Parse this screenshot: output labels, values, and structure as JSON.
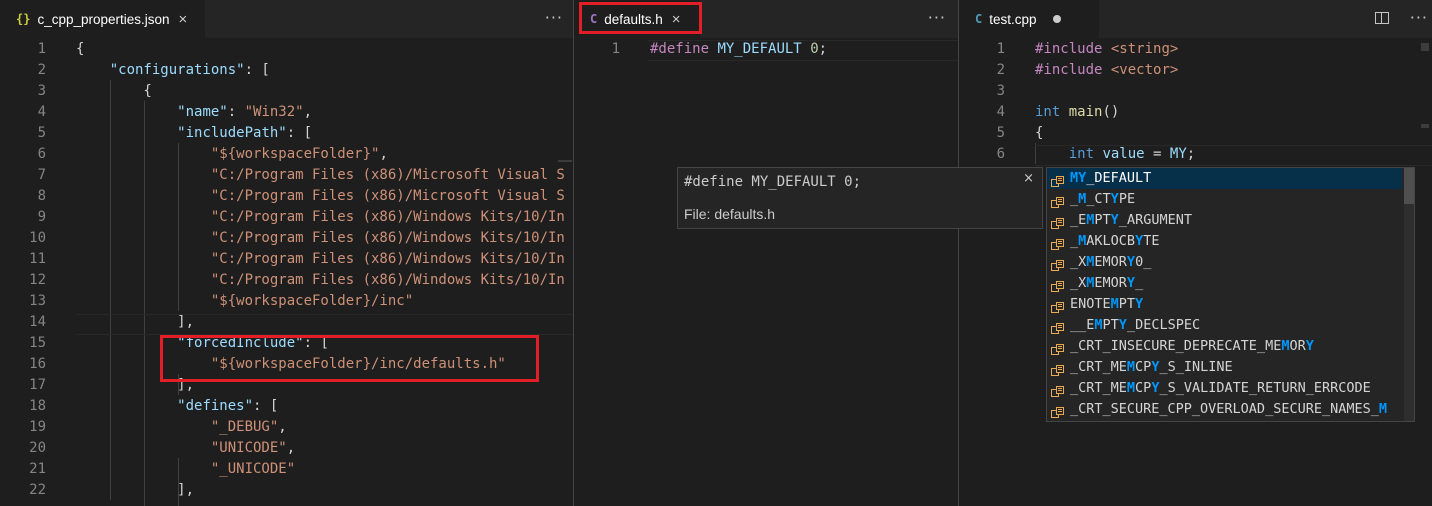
{
  "editors": [
    {
      "tab": {
        "icon": "{}",
        "icon_name": "json-icon",
        "label": "c_cpp_properties.json",
        "close": "×"
      },
      "more": "···",
      "lines": [
        {
          "n": "1",
          "parts": [
            [
              "p",
              "{"
            ]
          ]
        },
        {
          "n": "2",
          "parts": [
            [
              "p",
              "    "
            ],
            [
              "k",
              "\"configurations\""
            ],
            [
              "p",
              ": ["
            ]
          ]
        },
        {
          "n": "3",
          "parts": [
            [
              "p",
              "        {"
            ]
          ]
        },
        {
          "n": "4",
          "parts": [
            [
              "p",
              "            "
            ],
            [
              "k",
              "\"name\""
            ],
            [
              "p",
              ": "
            ],
            [
              "s",
              "\"Win32\""
            ],
            [
              "p",
              ","
            ]
          ]
        },
        {
          "n": "5",
          "parts": [
            [
              "p",
              "            "
            ],
            [
              "k",
              "\"includePath\""
            ],
            [
              "p",
              ": ["
            ]
          ]
        },
        {
          "n": "6",
          "parts": [
            [
              "p",
              "                "
            ],
            [
              "s",
              "\"${workspaceFolder}\""
            ],
            [
              "p",
              ","
            ]
          ]
        },
        {
          "n": "7",
          "parts": [
            [
              "p",
              "                "
            ],
            [
              "s",
              "\"C:/Program Files (x86)/Microsoft Visual S"
            ]
          ]
        },
        {
          "n": "8",
          "parts": [
            [
              "p",
              "                "
            ],
            [
              "s",
              "\"C:/Program Files (x86)/Microsoft Visual S"
            ]
          ]
        },
        {
          "n": "9",
          "parts": [
            [
              "p",
              "                "
            ],
            [
              "s",
              "\"C:/Program Files (x86)/Windows Kits/10/In"
            ]
          ]
        },
        {
          "n": "10",
          "parts": [
            [
              "p",
              "                "
            ],
            [
              "s",
              "\"C:/Program Files (x86)/Windows Kits/10/In"
            ]
          ]
        },
        {
          "n": "11",
          "parts": [
            [
              "p",
              "                "
            ],
            [
              "s",
              "\"C:/Program Files (x86)/Windows Kits/10/In"
            ]
          ]
        },
        {
          "n": "12",
          "parts": [
            [
              "p",
              "                "
            ],
            [
              "s",
              "\"C:/Program Files (x86)/Windows Kits/10/In"
            ]
          ]
        },
        {
          "n": "13",
          "parts": [
            [
              "p",
              "                "
            ],
            [
              "s",
              "\"${workspaceFolder}/inc\""
            ]
          ]
        },
        {
          "n": "14",
          "parts": [
            [
              "p",
              "            ],"
            ]
          ]
        },
        {
          "n": "15",
          "parts": [
            [
              "p",
              "            "
            ],
            [
              "k",
              "\"forcedInclude\""
            ],
            [
              "p",
              ": ["
            ]
          ]
        },
        {
          "n": "16",
          "parts": [
            [
              "p",
              "                "
            ],
            [
              "s",
              "\"${workspaceFolder}/inc/defaults.h\""
            ]
          ]
        },
        {
          "n": "17",
          "parts": [
            [
              "p",
              "            ],"
            ]
          ]
        },
        {
          "n": "18",
          "parts": [
            [
              "p",
              "            "
            ],
            [
              "k",
              "\"defines\""
            ],
            [
              "p",
              ": ["
            ]
          ]
        },
        {
          "n": "19",
          "parts": [
            [
              "p",
              "                "
            ],
            [
              "s",
              "\"_DEBUG\""
            ],
            [
              "p",
              ","
            ]
          ]
        },
        {
          "n": "20",
          "parts": [
            [
              "p",
              "                "
            ],
            [
              "s",
              "\"UNICODE\""
            ],
            [
              "p",
              ","
            ]
          ]
        },
        {
          "n": "21",
          "parts": [
            [
              "p",
              "                "
            ],
            [
              "s",
              "\"_UNICODE\""
            ]
          ]
        },
        {
          "n": "22",
          "parts": [
            [
              "p",
              "            ],"
            ]
          ]
        }
      ]
    },
    {
      "tab": {
        "icon": "C",
        "icon_name": "c-header-icon",
        "label": "defaults.h",
        "close": "×"
      },
      "more": "···",
      "lines": [
        {
          "n": "1",
          "parts": [
            [
              "pp",
              "#define"
            ],
            [
              "p",
              " "
            ],
            [
              "vr",
              "MY_DEFAULT"
            ],
            [
              "p",
              " "
            ],
            [
              "nm",
              "0"
            ],
            [
              "p",
              ";"
            ]
          ]
        }
      ]
    },
    {
      "tab": {
        "icon": "C",
        "icon_name": "cpp-file-icon",
        "label": "test.cpp"
      },
      "more": "···",
      "lines": [
        {
          "n": "1",
          "parts": [
            [
              "pp",
              "#include"
            ],
            [
              "p",
              " "
            ],
            [
              "s",
              "<string>"
            ]
          ]
        },
        {
          "n": "2",
          "parts": [
            [
              "pp",
              "#include"
            ],
            [
              "p",
              " "
            ],
            [
              "s",
              "<vector>"
            ]
          ]
        },
        {
          "n": "3",
          "parts": []
        },
        {
          "n": "4",
          "parts": [
            [
              "kw",
              "int"
            ],
            [
              "p",
              " "
            ],
            [
              "fn",
              "main"
            ],
            [
              "p",
              "()"
            ]
          ]
        },
        {
          "n": "5",
          "parts": [
            [
              "p",
              "{"
            ]
          ]
        },
        {
          "n": "6",
          "parts": [
            [
              "p",
              "    "
            ],
            [
              "kw",
              "int"
            ],
            [
              "p",
              " "
            ],
            [
              "vr",
              "value"
            ],
            [
              "p",
              " = "
            ],
            [
              "vr",
              "MY"
            ],
            [
              "p",
              ";"
            ]
          ]
        }
      ]
    }
  ],
  "hover": {
    "code": "#define MY_DEFAULT 0;",
    "file": "File: defaults.h",
    "close": "×"
  },
  "suggest": {
    "items": [
      [
        [
          "n",
          "MY"
        ],
        [
          "n",
          "_DEFAULT"
        ]
      ],
      [
        [
          "n",
          "_"
        ],
        [
          "m",
          "M"
        ],
        [
          "n",
          "_CT"
        ],
        [
          "m",
          "Y"
        ],
        [
          "n",
          "PE"
        ]
      ],
      [
        [
          "n",
          "_E"
        ],
        [
          "m",
          "M"
        ],
        [
          "n",
          "PT"
        ],
        [
          "m",
          "Y"
        ],
        [
          "n",
          "_ARGUMENT"
        ]
      ],
      [
        [
          "n",
          "_"
        ],
        [
          "m",
          "M"
        ],
        [
          "n",
          "AKLOCB"
        ],
        [
          "m",
          "Y"
        ],
        [
          "n",
          "TE"
        ]
      ],
      [
        [
          "n",
          "_X"
        ],
        [
          "m",
          "M"
        ],
        [
          "n",
          "EMOR"
        ],
        [
          "m",
          "Y"
        ],
        [
          "n",
          "0_"
        ]
      ],
      [
        [
          "n",
          "_X"
        ],
        [
          "m",
          "M"
        ],
        [
          "n",
          "EMOR"
        ],
        [
          "m",
          "Y"
        ],
        [
          "n",
          "_"
        ]
      ],
      [
        [
          "n",
          "ENOTE"
        ],
        [
          "m",
          "M"
        ],
        [
          "n",
          "PT"
        ],
        [
          "m",
          "Y"
        ]
      ],
      [
        [
          "n",
          "__E"
        ],
        [
          "m",
          "M"
        ],
        [
          "n",
          "PT"
        ],
        [
          "m",
          "Y"
        ],
        [
          "n",
          "_DECLSPEC"
        ]
      ],
      [
        [
          "n",
          "_CRT_INSECURE_DEPRECATE_ME"
        ],
        [
          "m",
          "M"
        ],
        [
          "n",
          "OR"
        ],
        [
          "m",
          "Y"
        ]
      ],
      [
        [
          "n",
          "_CRT_ME"
        ],
        [
          "m",
          "M"
        ],
        [
          "n",
          "CP"
        ],
        [
          "m",
          "Y"
        ],
        [
          "n",
          "_S_INLINE"
        ]
      ],
      [
        [
          "n",
          "_CRT_ME"
        ],
        [
          "m",
          "M"
        ],
        [
          "n",
          "CP"
        ],
        [
          "m",
          "Y"
        ],
        [
          "n",
          "_S_VALIDATE_RETURN_ERRCODE"
        ]
      ],
      [
        [
          "n",
          "_CRT_SECURE_CPP_OVERLOAD_SECURE_NAMES_"
        ],
        [
          "m",
          "M"
        ]
      ]
    ]
  }
}
